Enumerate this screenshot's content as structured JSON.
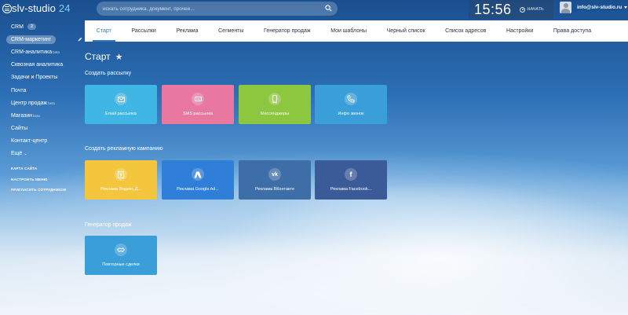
{
  "app": {
    "logo_name": "slv-studio",
    "logo_number": "24"
  },
  "header": {
    "search_placeholder": "искать сотрудника, документ, прочее...",
    "clock": "15:56",
    "start_day_label": "НАЧАТЬ",
    "user_email": "info@slv-studio.ru"
  },
  "sidebar": {
    "items": [
      {
        "label": "CRM",
        "badge": "2"
      },
      {
        "label": "CRM-маркетинг"
      },
      {
        "label": "CRM-аналитика",
        "sup": "beta"
      },
      {
        "label": "Сквозная аналитика"
      },
      {
        "label": "Задачи и Проекты"
      },
      {
        "label": "Почта"
      },
      {
        "label": "Центр продаж",
        "sup": "beta"
      },
      {
        "label": "Магазин",
        "sup": "beta"
      },
      {
        "label": "Сайты"
      },
      {
        "label": "Контакт-центр"
      },
      {
        "label": "Ещё"
      }
    ],
    "small_links": [
      "КАРТА САЙТА",
      "НАСТРОИТЬ МЕНЮ",
      "ПРИГЛАСИТЬ СОТРУДНИКОВ"
    ]
  },
  "tabs": [
    "Старт",
    "Рассылки",
    "Реклама",
    "Сегменты",
    "Генератор продаж",
    "Мои шаблоны",
    "Черный список",
    "Список адресов",
    "Настройки",
    "Права доступа"
  ],
  "main": {
    "title": "Старт",
    "sections": [
      {
        "title": "Создать рассылку",
        "tiles": [
          {
            "label": "Email рассылка",
            "color": "#3fb6e4",
            "icon": "email-icon"
          },
          {
            "label": "SMS рассылка",
            "color": "#e8789f",
            "icon": "sms-icon"
          },
          {
            "label": "Мессенджеры",
            "color": "#8dc63f",
            "icon": "phone-icon"
          },
          {
            "label": "Инфо звонок",
            "color": "#3a9fd8",
            "icon": "call-icon"
          }
        ]
      },
      {
        "title": "Создать рекламную кампанию",
        "tiles": [
          {
            "label": "Реклама Яндекс.Д...",
            "color": "#f4c63d",
            "icon": "yandex-icon"
          },
          {
            "label": "Реклама Google Ad...",
            "color": "#2f7ed8",
            "icon": "google-ads-icon"
          },
          {
            "label": "Реклама ВКонтакте",
            "color": "#3e6ea7",
            "icon": "vk-icon"
          },
          {
            "label": "Реклама Facebook...",
            "color": "#3b5b98",
            "icon": "facebook-icon"
          }
        ]
      },
      {
        "title": "Генератор продаж",
        "tiles": [
          {
            "label": "Повторные сделки",
            "color": "#3a9fd8",
            "icon": "handshake-icon"
          }
        ]
      }
    ]
  }
}
